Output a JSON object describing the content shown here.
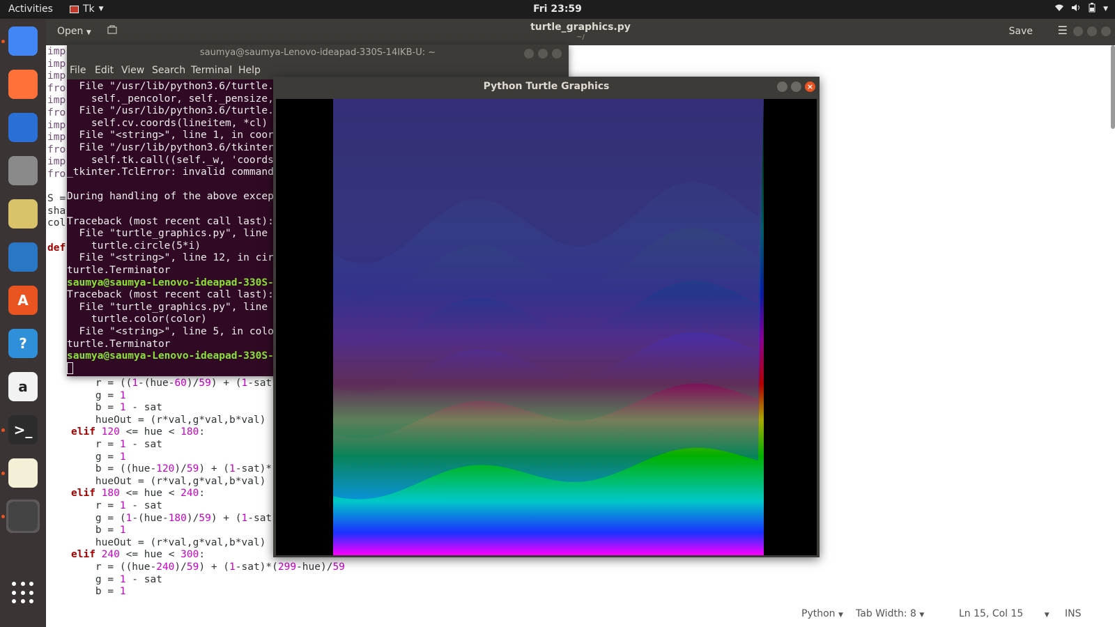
{
  "topbar": {
    "activities": "Activities",
    "app_name": "Tk",
    "clock": "Fri 23:59",
    "tray_icons": [
      "wifi-icon",
      "volume-icon",
      "battery-icon",
      "chevron-down-icon"
    ]
  },
  "dock": {
    "items": [
      {
        "name": "chrome",
        "glyph": "",
        "color": "#4285f4",
        "running": true
      },
      {
        "name": "firefox",
        "glyph": "",
        "color": "#ff7139",
        "running": false
      },
      {
        "name": "thunderbird",
        "glyph": "",
        "color": "#2a6fd6",
        "running": false
      },
      {
        "name": "files",
        "glyph": "",
        "color": "#8a8a8a",
        "running": false
      },
      {
        "name": "rhythmbox",
        "glyph": "",
        "color": "#d8c36a",
        "running": false
      },
      {
        "name": "writer",
        "glyph": "",
        "color": "#2a78c5",
        "running": false
      },
      {
        "name": "software",
        "glyph": "A",
        "color": "#e95420",
        "running": false
      },
      {
        "name": "help",
        "glyph": "?",
        "color": "#2f8fd8",
        "running": false
      },
      {
        "name": "amazon",
        "glyph": "a",
        "color": "#f2f2f2",
        "running": false
      },
      {
        "name": "terminal",
        "glyph": ">_",
        "color": "#2c2c2c",
        "running": true
      },
      {
        "name": "text-editor",
        "glyph": "",
        "color": "#f3f0d7",
        "running": true
      },
      {
        "name": "tk-app",
        "glyph": "",
        "color": "#444",
        "running": true
      }
    ],
    "show_apps": "show-applications-icon"
  },
  "gedit": {
    "open_label": "Open",
    "title": "turtle_graphics.py",
    "subtitle": "~/",
    "save_label": "Save",
    "status": {
      "language": "Python",
      "tab_width": "Tab Width: 8",
      "position": "Ln 15, Col 15",
      "mode": "INS"
    }
  },
  "editor_visible_fragments": [
    {
      "text": "imp",
      "cls": "imp"
    },
    {
      "text": "imp",
      "cls": "imp"
    },
    {
      "text": "imp",
      "cls": "imp"
    },
    {
      "text": "fro",
      "cls": "imp"
    },
    {
      "text": "imp",
      "cls": "imp"
    },
    {
      "text": "fro",
      "cls": "imp"
    },
    {
      "text": "imp",
      "cls": "imp"
    },
    {
      "text": "imp",
      "cls": "imp"
    },
    {
      "text": "fro",
      "cls": "imp"
    },
    {
      "text": "imp",
      "cls": "imp"
    },
    {
      "text": "fro",
      "cls": "imp"
    },
    {
      "text": "",
      "cls": ""
    },
    {
      "text": "S =",
      "cls": ""
    },
    {
      "text": "sha",
      "cls": ""
    },
    {
      "text": "col",
      "cls": ""
    },
    {
      "text": "",
      "cls": ""
    },
    {
      "text": "def",
      "cls": "kw"
    }
  ],
  "editor_code": [
    [
      {
        "t": "    r = ((",
        "c": ""
      },
      {
        "t": "1",
        "c": "num"
      },
      {
        "t": "-(hue-",
        "c": ""
      },
      {
        "t": "60",
        "c": "num"
      },
      {
        "t": ")/",
        "c": ""
      },
      {
        "t": "59",
        "c": "num"
      },
      {
        "t": ") + (",
        "c": ""
      },
      {
        "t": "1",
        "c": "num"
      },
      {
        "t": "-sat",
        "c": ""
      }
    ],
    [
      {
        "t": "    g = ",
        "c": ""
      },
      {
        "t": "1",
        "c": "num"
      }
    ],
    [
      {
        "t": "    b = ",
        "c": ""
      },
      {
        "t": "1",
        "c": "num"
      },
      {
        "t": " - sat",
        "c": ""
      }
    ],
    [
      {
        "t": "    hueOut = (r*val,g*val,b*val)",
        "c": ""
      }
    ],
    [
      {
        "t": "elif",
        "c": "kw"
      },
      {
        "t": " ",
        "c": ""
      },
      {
        "t": "120",
        "c": "num"
      },
      {
        "t": " <= hue < ",
        "c": ""
      },
      {
        "t": "180",
        "c": "num"
      },
      {
        "t": ":",
        "c": ""
      }
    ],
    [
      {
        "t": "    r = ",
        "c": ""
      },
      {
        "t": "1",
        "c": "num"
      },
      {
        "t": " - sat",
        "c": ""
      }
    ],
    [
      {
        "t": "    g = ",
        "c": ""
      },
      {
        "t": "1",
        "c": "num"
      }
    ],
    [
      {
        "t": "    b = ((hue-",
        "c": ""
      },
      {
        "t": "120",
        "c": "num"
      },
      {
        "t": ")/",
        "c": ""
      },
      {
        "t": "59",
        "c": "num"
      },
      {
        "t": ") + (",
        "c": ""
      },
      {
        "t": "1",
        "c": "num"
      },
      {
        "t": "-sat)*",
        "c": ""
      }
    ],
    [
      {
        "t": "    hueOut = (r*val,g*val,b*val)",
        "c": ""
      }
    ],
    [
      {
        "t": "elif",
        "c": "kw"
      },
      {
        "t": " ",
        "c": ""
      },
      {
        "t": "180",
        "c": "num"
      },
      {
        "t": " <= hue < ",
        "c": ""
      },
      {
        "t": "240",
        "c": "num"
      },
      {
        "t": ":",
        "c": ""
      }
    ],
    [
      {
        "t": "    r = ",
        "c": ""
      },
      {
        "t": "1",
        "c": "num"
      },
      {
        "t": " - sat",
        "c": ""
      }
    ],
    [
      {
        "t": "    g = (",
        "c": ""
      },
      {
        "t": "1",
        "c": "num"
      },
      {
        "t": "-(hue-",
        "c": ""
      },
      {
        "t": "180",
        "c": "num"
      },
      {
        "t": ")/",
        "c": ""
      },
      {
        "t": "59",
        "c": "num"
      },
      {
        "t": ") + (",
        "c": ""
      },
      {
        "t": "1",
        "c": "num"
      },
      {
        "t": "-sat",
        "c": ""
      }
    ],
    [
      {
        "t": "    b = ",
        "c": ""
      },
      {
        "t": "1",
        "c": "num"
      }
    ],
    [
      {
        "t": "    hueOut = (r*val,g*val,b*val)",
        "c": ""
      }
    ],
    [
      {
        "t": "elif",
        "c": "kw"
      },
      {
        "t": " ",
        "c": ""
      },
      {
        "t": "240",
        "c": "num"
      },
      {
        "t": " <= hue < ",
        "c": ""
      },
      {
        "t": "300",
        "c": "num"
      },
      {
        "t": ":",
        "c": ""
      }
    ],
    [
      {
        "t": "    r = ((hue-",
        "c": ""
      },
      {
        "t": "240",
        "c": "num"
      },
      {
        "t": ")/",
        "c": ""
      },
      {
        "t": "59",
        "c": "num"
      },
      {
        "t": ") + (",
        "c": ""
      },
      {
        "t": "1",
        "c": "num"
      },
      {
        "t": "-sat)*(",
        "c": ""
      },
      {
        "t": "299",
        "c": "num"
      },
      {
        "t": "-hue)/",
        "c": ""
      },
      {
        "t": "59",
        "c": "num"
      }
    ],
    [
      {
        "t": "    g = ",
        "c": ""
      },
      {
        "t": "1",
        "c": "num"
      },
      {
        "t": " - sat",
        "c": ""
      }
    ],
    [
      {
        "t": "    b = ",
        "c": ""
      },
      {
        "t": "1",
        "c": "num"
      }
    ]
  ],
  "terminal": {
    "title": "saumya@saumya-Lenovo-ideapad-330S-14IKB-U: ~",
    "menu": [
      "File",
      "Edit",
      "View",
      "Search",
      "Terminal",
      "Help"
    ],
    "lines": [
      {
        "text": "  File \"/usr/lib/python3.6/turtle.",
        "prompt": false
      },
      {
        "text": "    self._pencolor, self._pensize,",
        "prompt": false
      },
      {
        "text": "  File \"/usr/lib/python3.6/turtle.",
        "prompt": false
      },
      {
        "text": "    self.cv.coords(lineitem, *cl)",
        "prompt": false
      },
      {
        "text": "  File \"<string>\", line 1, in coor",
        "prompt": false
      },
      {
        "text": "  File \"/usr/lib/python3.6/tkinter",
        "prompt": false
      },
      {
        "text": "    self.tk.call((self._w, 'coords",
        "prompt": false
      },
      {
        "text": "_tkinter.TclError: invalid command",
        "prompt": false
      },
      {
        "text": "",
        "prompt": false
      },
      {
        "text": "During handling of the above excep",
        "prompt": false
      },
      {
        "text": "",
        "prompt": false
      },
      {
        "text": "Traceback (most recent call last):",
        "prompt": false
      },
      {
        "text": "  File \"turtle_graphics.py\", line",
        "prompt": false
      },
      {
        "text": "    turtle.circle(5*i)",
        "prompt": false
      },
      {
        "text": "  File \"<string>\", line 12, in cir",
        "prompt": false
      },
      {
        "text": "turtle.Terminator",
        "prompt": false
      },
      {
        "text": "saumya@saumya-Lenovo-ideapad-330S-",
        "prompt": true
      },
      {
        "text": "Traceback (most recent call last):",
        "prompt": false
      },
      {
        "text": "  File \"turtle_graphics.py\", line",
        "prompt": false
      },
      {
        "text": "    turtle.color(color)",
        "prompt": false
      },
      {
        "text": "  File \"<string>\", line 5, in colo",
        "prompt": false
      },
      {
        "text": "turtle.Terminator",
        "prompt": false
      },
      {
        "text": "saumya@saumya-Lenovo-ideapad-330S-",
        "prompt": true
      }
    ]
  },
  "turtle_window": {
    "title": "Python Turtle Graphics",
    "band_colors": [
      "#000000",
      "#003a10",
      "#006060",
      "#0a1a9c",
      "#8a0090",
      "#b00000",
      "#a8a800",
      "#00b000",
      "#00c8c8",
      "#1a30ff",
      "#ff00ff"
    ]
  }
}
